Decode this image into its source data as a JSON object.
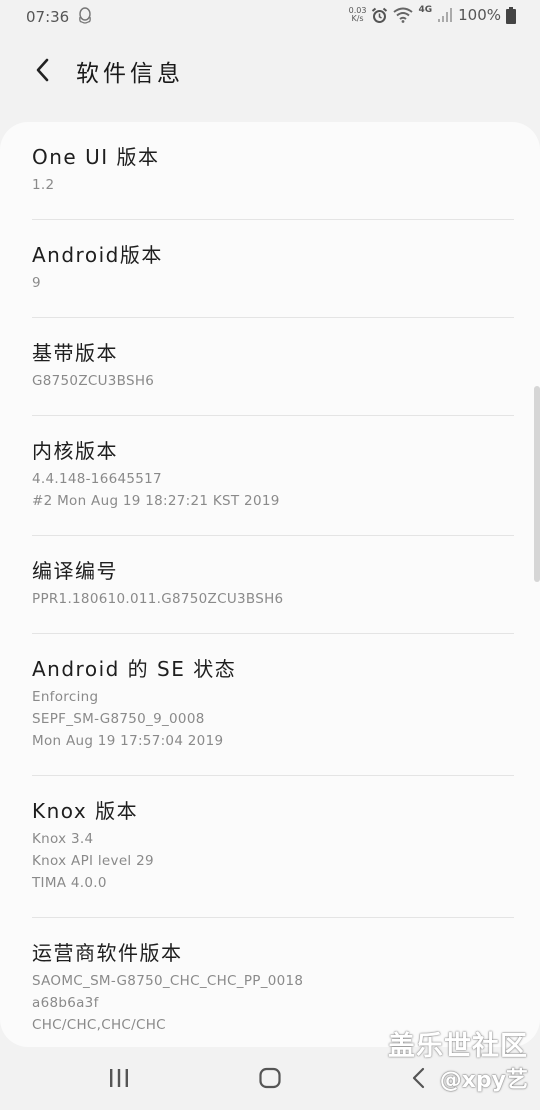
{
  "status_bar": {
    "time": "07:36",
    "net_speed_value": "0.03",
    "net_speed_unit": "K/s",
    "network": "4G",
    "battery": "100%"
  },
  "header": {
    "title": "软件信息"
  },
  "items": [
    {
      "title": "One UI 版本",
      "lines": [
        "1.2"
      ]
    },
    {
      "title": "Android版本",
      "lines": [
        "9"
      ]
    },
    {
      "title": "基带版本",
      "lines": [
        "G8750ZCU3BSH6"
      ]
    },
    {
      "title": "内核版本",
      "lines": [
        "4.4.148-16645517",
        "#2 Mon Aug 19 18:27:21 KST 2019"
      ]
    },
    {
      "title": "编译编号",
      "lines": [
        "PPR1.180610.011.G8750ZCU3BSH6"
      ]
    },
    {
      "title": "Android 的 SE 状态",
      "lines": [
        "Enforcing",
        "SEPF_SM-G8750_9_0008",
        "Mon Aug 19 17:57:04 2019"
      ]
    },
    {
      "title": "Knox 版本",
      "lines": [
        "Knox 3.4",
        "Knox API level 29",
        "TIMA 4.0.0"
      ]
    },
    {
      "title": "运营商软件版本",
      "lines": [
        "SAOMC_SM-G8750_CHC_CHC_PP_0018",
        "a68b6a3f",
        "CHC/CHC,CHC/CHC"
      ]
    }
  ],
  "watermark": {
    "site": "盖乐世社区",
    "user": "@xpy艺"
  },
  "icons": {
    "back": "chevron-left-icon",
    "qq": "qq-penguin-icon",
    "alarm": "alarm-clock-icon",
    "wifi": "wifi-icon",
    "signal": "signal-icon",
    "battery": "battery-icon"
  }
}
